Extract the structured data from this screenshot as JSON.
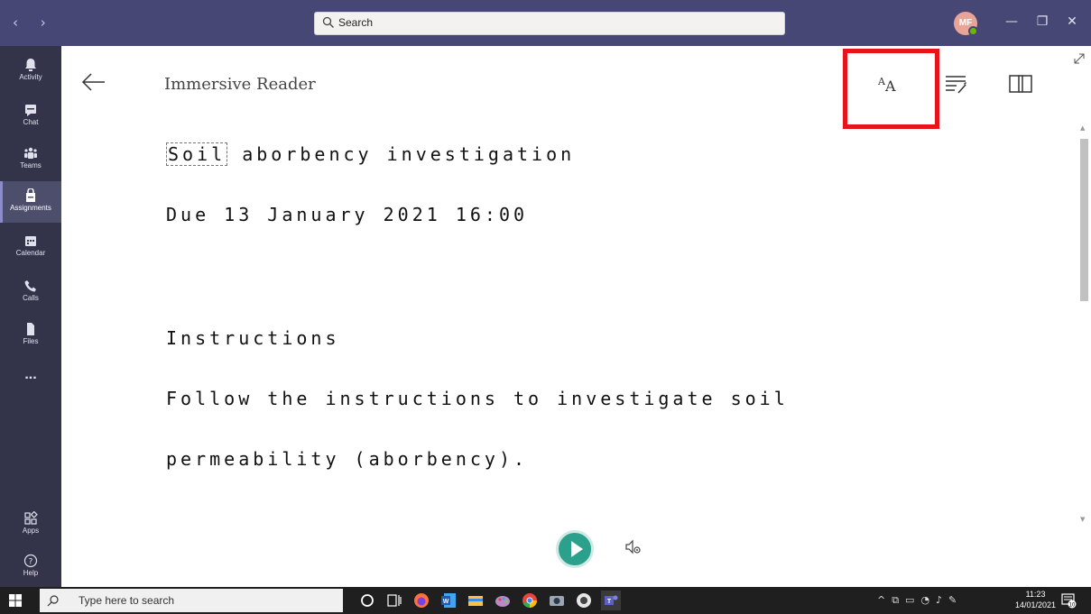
{
  "titlebar": {
    "nav_arrows": "‹  ›",
    "search_placeholder": "Search",
    "avatar_initials": "MF",
    "min": "—",
    "restore": "❐",
    "close": "✕",
    "bg_color": "#464775"
  },
  "rail": {
    "items": [
      {
        "label": "Activity",
        "icon": "bell-icon"
      },
      {
        "label": "Chat",
        "icon": "chat-icon"
      },
      {
        "label": "Teams",
        "icon": "teams-icon"
      },
      {
        "label": "Assignments",
        "icon": "assignments-icon",
        "active": true
      },
      {
        "label": "Calendar",
        "icon": "calendar-icon"
      },
      {
        "label": "Calls",
        "icon": "phone-icon"
      },
      {
        "label": "Files",
        "icon": "file-icon"
      },
      {
        "label": "...",
        "icon": "more-icon"
      }
    ],
    "apps_label": "Apps",
    "help_label": "Help"
  },
  "reader": {
    "title": "Immersive Reader",
    "tools": [
      "text-preferences-icon",
      "grammar-options-icon",
      "reading-preferences-icon"
    ],
    "highlight_color": "#e8141b",
    "lines": [
      {
        "focus": "Soil",
        "rest": " aborbency investigation"
      },
      {
        "text": "Due 13 January 2021 16:00"
      },
      {
        "text": "Instructions"
      },
      {
        "text": "Follow the instructions to investigate soil"
      },
      {
        "text": "permeability (aborbency)."
      }
    ],
    "play_color": "#2aa08d"
  },
  "taskbar": {
    "search_placeholder": "Type here to search",
    "time": "11:23",
    "date": "14/01/2021",
    "notifications": "10"
  }
}
